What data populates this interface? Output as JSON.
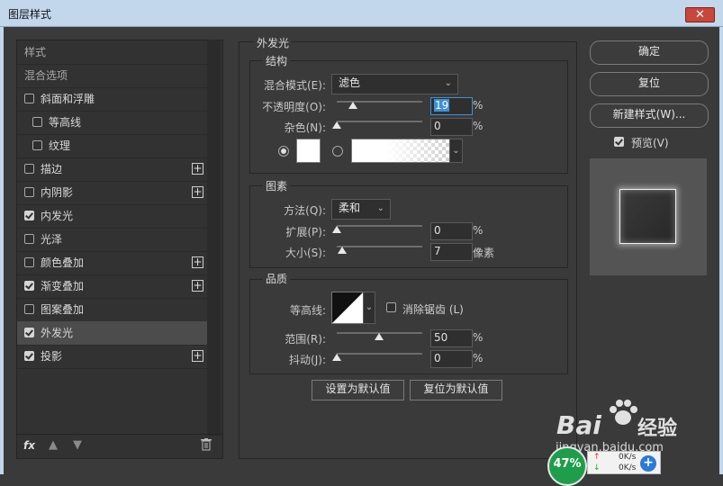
{
  "window": {
    "title": "图层样式",
    "close_label": "✕"
  },
  "left_panel": {
    "header_style": "样式",
    "header_blend": "混合选项",
    "items": [
      {
        "label": "斜面和浮雕",
        "checked": false,
        "plus": false
      },
      {
        "label": "等高线",
        "checked": false,
        "plus": false
      },
      {
        "label": "纹理",
        "checked": false,
        "plus": false
      },
      {
        "label": "描边",
        "checked": false,
        "plus": true
      },
      {
        "label": "内阴影",
        "checked": false,
        "plus": true
      },
      {
        "label": "内发光",
        "checked": true,
        "plus": false
      },
      {
        "label": "光泽",
        "checked": false,
        "plus": false
      },
      {
        "label": "颜色叠加",
        "checked": false,
        "plus": true
      },
      {
        "label": "渐变叠加",
        "checked": true,
        "plus": true
      },
      {
        "label": "图案叠加",
        "checked": false,
        "plus": false
      },
      {
        "label": "外发光",
        "checked": true,
        "plus": false,
        "selected": true
      },
      {
        "label": "投影",
        "checked": true,
        "plus": true
      }
    ],
    "fx_label": "fx",
    "plus_glyph": "+"
  },
  "outer_glow": {
    "title": "外发光",
    "structure": {
      "title": "结构",
      "blend_mode_label": "混合模式(E):",
      "blend_mode_value": "滤色",
      "opacity_label": "不透明度(O):",
      "opacity_value": "19",
      "noise_label": "杂色(N):",
      "noise_value": "0",
      "percent": "%",
      "opacity_fraction": 0.19,
      "noise_fraction": 0.0
    },
    "elements": {
      "title": "图素",
      "method_label": "方法(Q):",
      "method_value": "柔和",
      "spread_label": "扩展(P):",
      "spread_value": "0",
      "size_label": "大小(S):",
      "size_value": "7",
      "percent": "%",
      "pixels": "像素"
    },
    "quality": {
      "title": "品质",
      "contour_label": "等高线:",
      "antialias_label": "消除锯齿 (L)",
      "range_label": "范围(R):",
      "range_value": "50",
      "jitter_label": "抖动(J):",
      "jitter_value": "0",
      "percent": "%"
    },
    "make_default": "设置为默认值",
    "reset_default": "复位为默认值"
  },
  "right_panel": {
    "ok": "确定",
    "reset": "复位",
    "new_style": "新建样式(W)...",
    "preview_label": "预览(V)"
  },
  "overlay": {
    "watermark_brand": "Bai",
    "watermark_cn": "经验",
    "watermark_url": "jingyan.baidu.com",
    "cpu_percent": "47%",
    "net_up": "0K/s",
    "net_down": "0K/s"
  }
}
